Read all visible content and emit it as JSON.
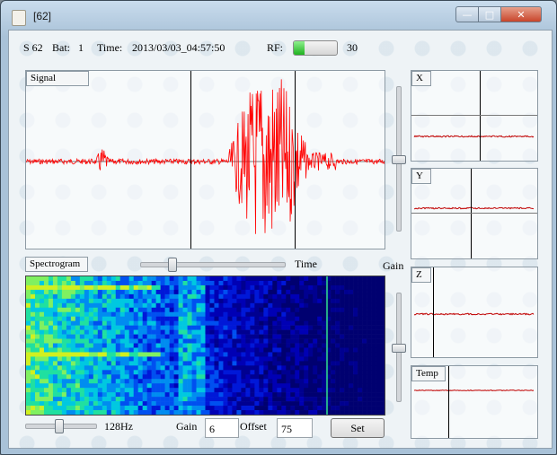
{
  "window": {
    "title": "[62]",
    "minimize_icon": "minimize-icon",
    "maximize_icon": "maximize-icon",
    "close_icon": "close-icon"
  },
  "status": {
    "station": "S 62",
    "bat_label": "Bat:",
    "bat_value": "1",
    "time_label": "Time:",
    "time_value": "2013/03/03_04:57:50",
    "rf_label": "RF:",
    "rf_value": "30",
    "rf_level": 0.25
  },
  "signal_panel": {
    "label": "Signal"
  },
  "spectrogram": {
    "label": "Spectrogram",
    "time_label": "Time",
    "time_slider": 0.2,
    "freq_label": "128Hz",
    "freq_slider": 0.45
  },
  "gain": {
    "label": "Gain",
    "signal_slider": 0.5,
    "spectro_slider": 0.5
  },
  "controls": {
    "gain_label": "Gain",
    "gain_value": "6",
    "offset_label": "Offset",
    "offset_value": "75",
    "set_label": "Set"
  },
  "axes": [
    {
      "label": "X"
    },
    {
      "label": "Y"
    },
    {
      "label": "Z"
    },
    {
      "label": "Temp"
    }
  ],
  "colors": {
    "trace": "#ff0000",
    "axis_trace": "#c00000",
    "rf_fill": "#22b522"
  }
}
